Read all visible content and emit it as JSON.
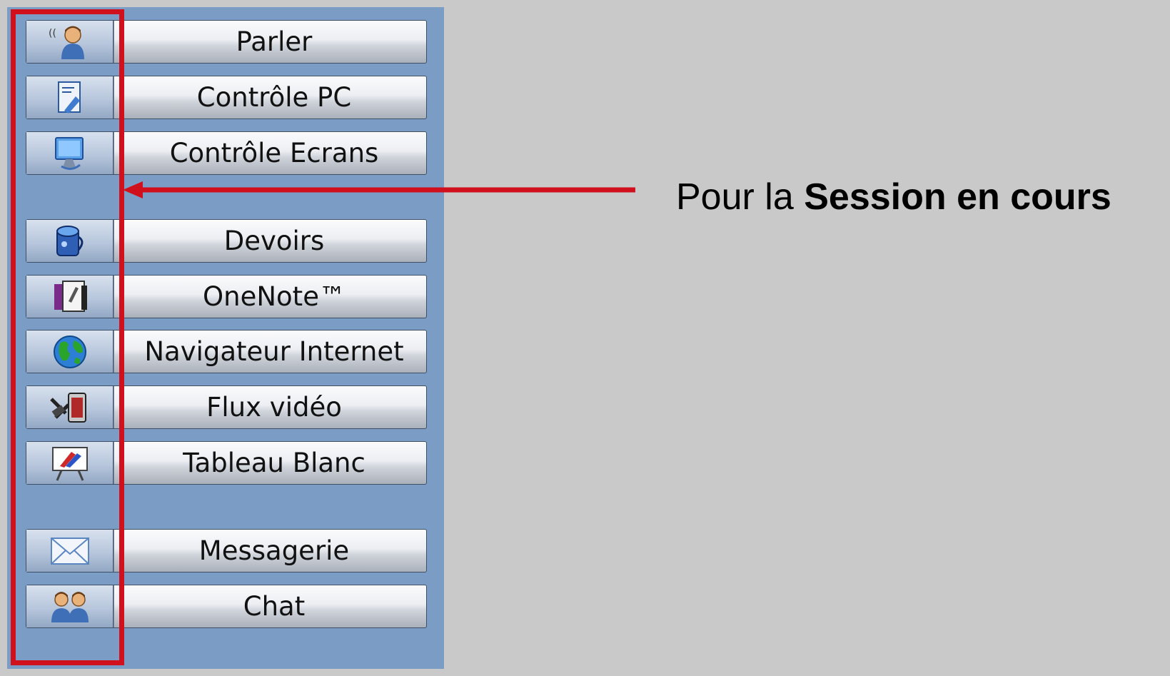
{
  "toolbar": {
    "buttons": [
      {
        "label": "Parler",
        "icon": "speaking-person-icon"
      },
      {
        "label": "Contrôle PC",
        "icon": "pc-control-icon"
      },
      {
        "label": "Contrôle Ecrans",
        "icon": "monitor-icon"
      },
      {
        "label": "Devoirs",
        "icon": "homework-icon"
      },
      {
        "label": "OneNote™",
        "icon": "onenote-icon"
      },
      {
        "label": "Navigateur Internet",
        "icon": "globe-icon"
      },
      {
        "label": "Flux vidéo",
        "icon": "video-stream-icon"
      },
      {
        "label": "Tableau Blanc",
        "icon": "whiteboard-icon"
      },
      {
        "label": "Messagerie",
        "icon": "envelope-icon"
      },
      {
        "label": "Chat",
        "icon": "chat-users-icon"
      }
    ]
  },
  "annotation": {
    "prefix": "Pour la ",
    "bold": "Session en cours"
  },
  "colors": {
    "panel": "#7b9cc4",
    "highlight": "#d0101c",
    "background": "#c9c9c9"
  }
}
